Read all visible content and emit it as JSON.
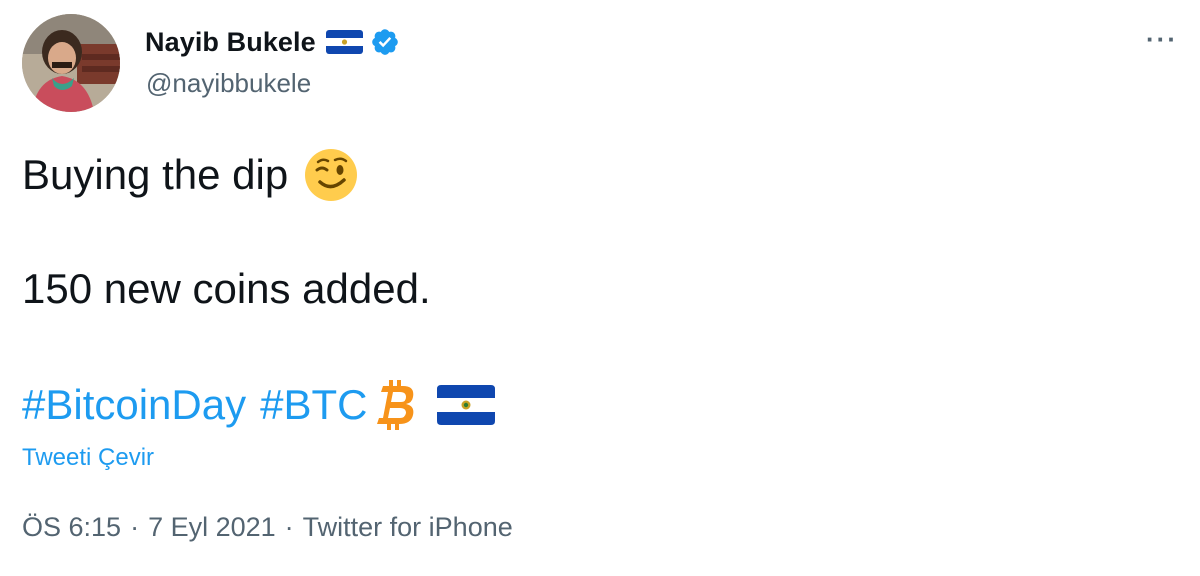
{
  "author": {
    "display_name": "Nayib Bukele",
    "handle": "@nayibbukele"
  },
  "tweet": {
    "line1": "Buying the dip",
    "line2": "150 new coins added.",
    "hashtags": [
      "#BitcoinDay",
      "#BTC"
    ],
    "translate_label": "Tweeti Çevir"
  },
  "meta": {
    "time": "ÖS 6:15",
    "separator": "·",
    "date": "7 Eyl 2021",
    "source": "Twitter for iPhone"
  },
  "icons": {
    "verified": "verified-badge-icon",
    "flag": "el-salvador-flag-icon",
    "wink": "winking-face-emoji-icon",
    "bitcoin": "bitcoin-icon",
    "more": "more-options-icon"
  },
  "colors": {
    "link_blue": "#1d9bf0",
    "text": "#0f1419",
    "secondary": "#536471",
    "bitcoin_orange": "#f7931a",
    "flag_blue": "#0f47af",
    "emoji_yellow": "#ffcc4d"
  }
}
